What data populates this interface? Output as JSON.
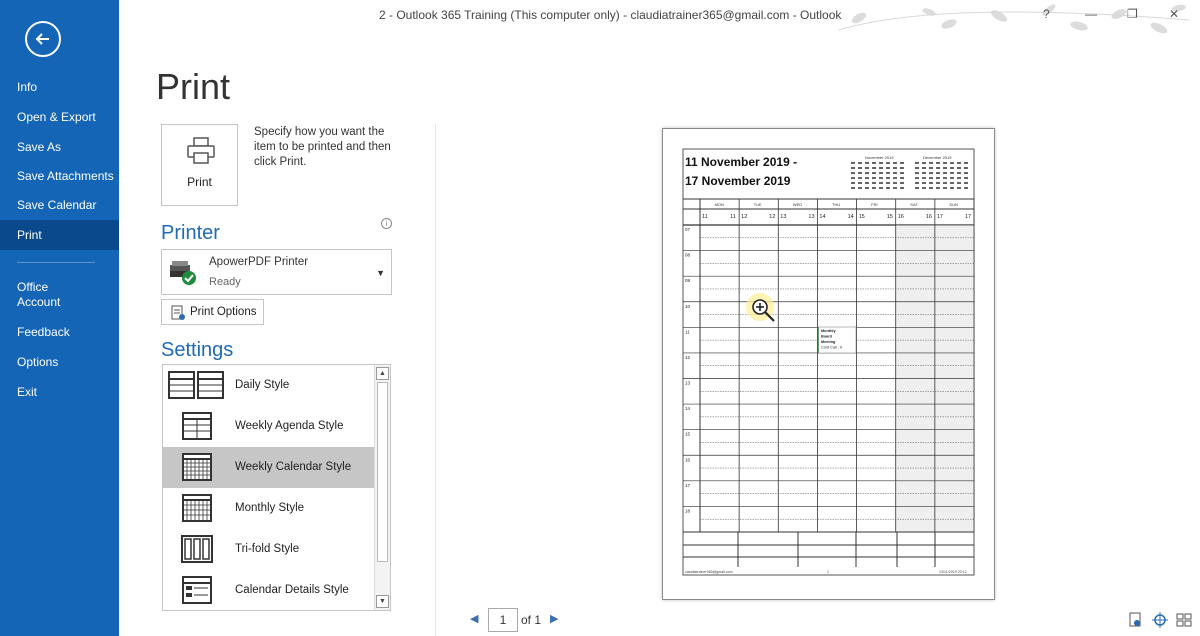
{
  "window": {
    "title": "2 - Outlook 365 Training (This computer only) - claudiatrainer365@gmail.com  -  Outlook",
    "help": "?",
    "minimize": "—",
    "restore": "❐",
    "close": "✕"
  },
  "sidebar": {
    "items": [
      {
        "label": "Info"
      },
      {
        "label": "Open & Export"
      },
      {
        "label": "Save As"
      },
      {
        "label": "Save Attachments"
      },
      {
        "label": "Save Calendar"
      },
      {
        "label": "Print"
      },
      {
        "label": "Office\nAccount"
      },
      {
        "label": "Feedback"
      },
      {
        "label": "Options"
      },
      {
        "label": "Exit"
      }
    ],
    "active": "Print"
  },
  "main": {
    "title": "Print",
    "print_button_label": "Print",
    "print_description": "Specify how you want the item to be printed and then click Print.",
    "printer_heading": "Printer",
    "printer_name": "ApowerPDF Printer",
    "printer_status": "Ready",
    "print_options_label": "Print Options",
    "settings_heading": "Settings",
    "styles": [
      {
        "label": "Daily Style"
      },
      {
        "label": "Weekly Agenda Style"
      },
      {
        "label": "Weekly Calendar Style"
      },
      {
        "label": "Monthly Style"
      },
      {
        "label": "Tri-fold Style"
      },
      {
        "label": "Calendar Details Style"
      }
    ],
    "selected_style": "Weekly Calendar Style"
  },
  "preview": {
    "date_line1": "11 November 2019 -",
    "date_line2": "17 November 2019",
    "mini_cal_1_title": "November 2019",
    "mini_cal_2_title": "December 2019",
    "days": [
      "MON",
      "TUE",
      "WED",
      "THU",
      "FRI",
      "SAT",
      "SUN"
    ],
    "day_numbers": [
      "11",
      "11",
      "12",
      "12",
      "13",
      "13",
      "14",
      "14",
      "15",
      "15",
      "16",
      "16",
      "17",
      "17"
    ],
    "hours": [
      "07",
      "08",
      "09",
      "10",
      "11",
      "12",
      "13",
      "14",
      "15",
      "16",
      "17",
      "18"
    ],
    "event_lines": [
      "Monthly",
      "Board",
      "Meeting",
      "Conf Call : 9"
    ],
    "footer_left": "claudiatrainer365@gmail.com",
    "footer_mid": "1",
    "footer_right": "13/11/2019 20:12"
  },
  "pager": {
    "current_page": "1",
    "of_text": "of 1"
  },
  "colors": {
    "sidebar": "#1565b6",
    "sidebar_active": "#0a4a8c",
    "heading_blue": "#1f6bb7",
    "selected_item": "#c6c6c6"
  }
}
